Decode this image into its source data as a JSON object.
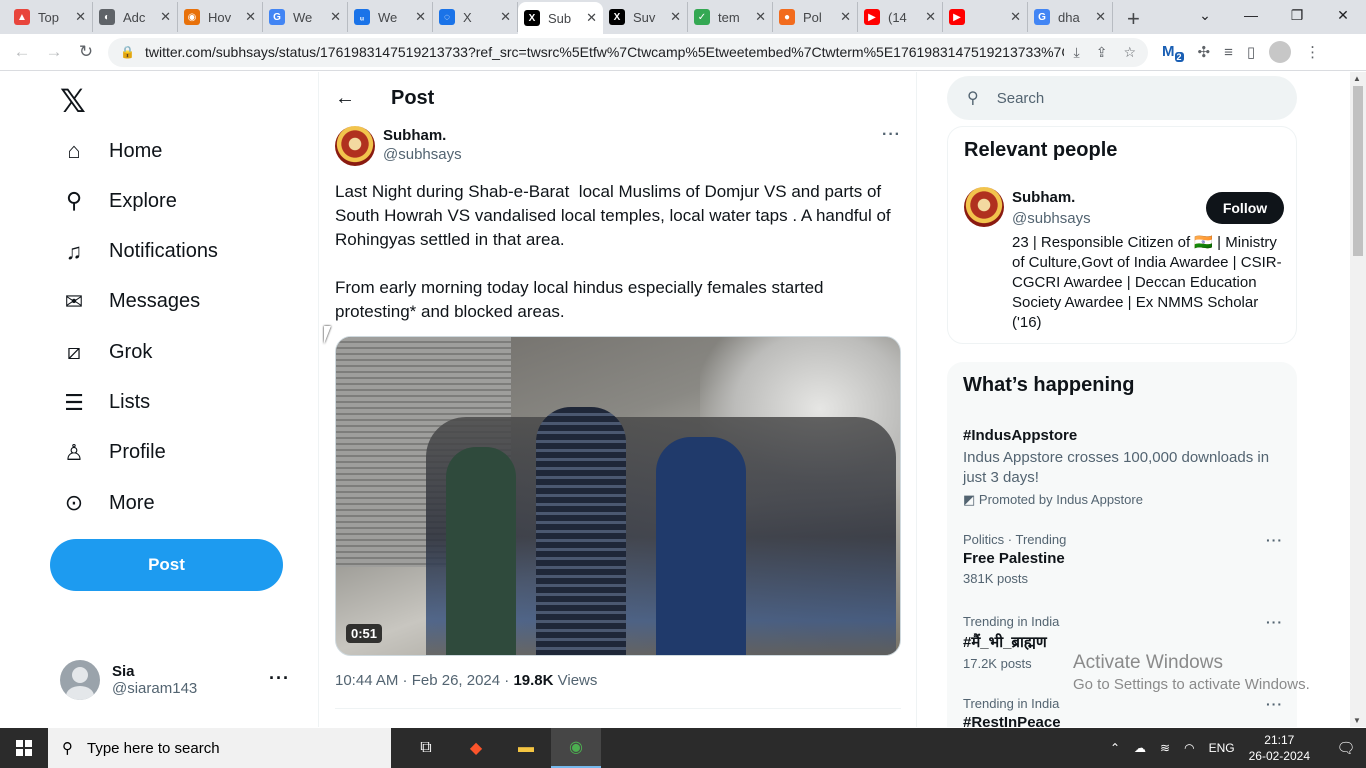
{
  "browser": {
    "tabs": [
      {
        "label": "Top",
        "color": "#e8453c",
        "glyph": "▲"
      },
      {
        "label": "Adc",
        "color": "#5f6368",
        "glyph": "◐"
      },
      {
        "label": "Hov",
        "color": "#e8710a",
        "glyph": "◉"
      },
      {
        "label": "We",
        "color": "#4285f4",
        "glyph": "G"
      },
      {
        "label": "We",
        "color": "#1a73e8",
        "glyph": "ᵤ"
      },
      {
        "label": "X",
        "color": "#1a73e8",
        "glyph": "◌"
      },
      {
        "label": "Sub",
        "color": "#000000",
        "glyph": "X",
        "active": true
      },
      {
        "label": "Suv",
        "color": "#000000",
        "glyph": "X"
      },
      {
        "label": "tem",
        "color": "#34a853",
        "glyph": "✓"
      },
      {
        "label": "Pol",
        "color": "#f26b1d",
        "glyph": "●"
      },
      {
        "label": "(14",
        "color": "#ff0000",
        "glyph": "▶"
      },
      {
        "label": "",
        "color": "#ff0000",
        "glyph": "▶"
      },
      {
        "label": "dha",
        "color": "#4285f4",
        "glyph": "G"
      }
    ],
    "url": "twitter.com/subhsays/status/1761983147519213733?ref_src=twsrc%5Etfw%7Ctwcamp%5Etweetembed%7Ctwterm%5E1761983147519213733%7Ct...",
    "ext_badge": "2"
  },
  "nav": {
    "items": [
      {
        "label": "Home",
        "icon": "home-icon",
        "glyph": "⌂"
      },
      {
        "label": "Explore",
        "icon": "search-icon",
        "glyph": "⚲"
      },
      {
        "label": "Notifications",
        "icon": "bell-icon",
        "glyph": "♫"
      },
      {
        "label": "Messages",
        "icon": "mail-icon",
        "glyph": "✉"
      },
      {
        "label": "Grok",
        "icon": "grok-icon",
        "glyph": "⧄"
      },
      {
        "label": "Lists",
        "icon": "list-icon",
        "glyph": "☰"
      },
      {
        "label": "Profile",
        "icon": "person-icon",
        "glyph": "♙"
      },
      {
        "label": "More",
        "icon": "more-circle-icon",
        "glyph": "⊙"
      }
    ],
    "post_label": "Post",
    "account": {
      "name": "Sia",
      "handle": "@siaram143"
    }
  },
  "main": {
    "header_title": "Post",
    "author": {
      "name": "Subham.",
      "handle": "@subhsays"
    },
    "text": "Last Night during Shab-e-Barat  local Muslims of Domjur VS and parts of South Howrah VS vandalised local temples, local water taps . A handful of  Rohingyas settled in that area.\n\nFrom early morning today local hindus especially females started protesting* and blocked areas.",
    "video_duration": "0:51",
    "timestamp": "10:44 AM · Feb 26, 2024 · ",
    "views_count": "19.8K",
    "views_label": " Views"
  },
  "right": {
    "search_placeholder": "Search",
    "relevant_title": "Relevant people",
    "relevant": {
      "name": "Subham.",
      "handle": "@subhsays",
      "follow_label": "Follow",
      "bio": "23 | Responsible Citizen of 🇮🇳 | Ministry of Culture,Govt of India Awardee | CSIR-CGCRI Awardee | Deccan Education Society Awardee | Ex NMMS Scholar ('16)"
    },
    "happening_title": "What’s happening",
    "promo": {
      "title": "#IndusAppstore",
      "desc": "Indus Appstore crosses 100,000 downloads in just 3 days!",
      "by": "Promoted by Indus Appstore"
    },
    "trends": [
      {
        "context": "Politics · Trending",
        "title": "Free Palestine",
        "posts": "381K posts"
      },
      {
        "context": "Trending in India",
        "title": "#मैं_भी_ब्राह्मण",
        "posts": "17.2K posts"
      },
      {
        "context": "Trending in India",
        "title": "#RestInPeace",
        "posts": ""
      }
    ]
  },
  "watermark": {
    "line1": "Activate Windows",
    "line2": "Go to Settings to activate Windows."
  },
  "taskbar": {
    "search_placeholder": "Type here to search",
    "lang": "ENG",
    "time": "21:17",
    "date": "26-02-2024"
  }
}
